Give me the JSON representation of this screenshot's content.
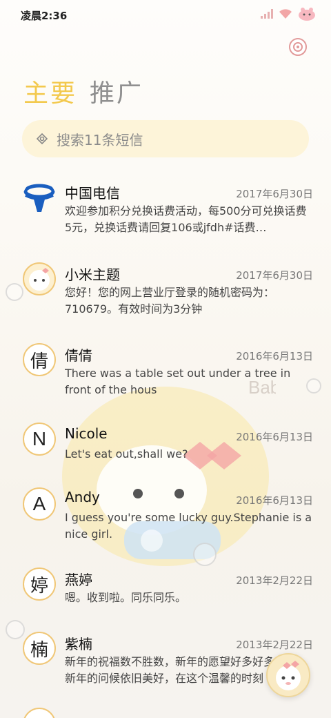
{
  "status_bar": {
    "time": "凌晨2:36"
  },
  "tabs": [
    {
      "label": "主要",
      "active": true
    },
    {
      "label": "推广",
      "active": false
    }
  ],
  "search": {
    "placeholder": "搜索11条短信"
  },
  "threads": [
    {
      "name": "中国电信",
      "date": "2017年6月30日",
      "preview": "欢迎参加积分兑换话费活动，每500分可兑换话费5元，兑换话费请回复106或jfdh#话费…",
      "avatar": ""
    },
    {
      "name": "小米主题",
      "date": "2017年6月30日",
      "preview": "您好！您的网上营业厅登录的随机密码为：710679。有效时间为3分钟",
      "avatar": ""
    },
    {
      "name": "倩倩",
      "date": "2016年6月13日",
      "preview": "There was a table set out under a tree in front of the hous",
      "avatar": "倩"
    },
    {
      "name": "Nicole",
      "date": "2016年6月13日",
      "preview": "Let's eat out,shall we?",
      "avatar": "N"
    },
    {
      "name": "Andy",
      "date": "2016年6月13日",
      "preview": "I guess you're some lucky guy.Stephanie is a nice girl.",
      "avatar": "A"
    },
    {
      "name": "燕婷",
      "date": "2013年2月22日",
      "preview": "嗯。收到啦。同乐同乐。",
      "avatar": "婷"
    },
    {
      "name": "紫楠",
      "date": "2013年2月22日",
      "preview": "新年的祝福数不胜数，新年的愿望好多好多，新年的问候依旧美好，在这个温馨的时刻",
      "avatar": "楠"
    }
  ],
  "colors": {
    "accent": "#f3c94e",
    "search_bg": "#fdf4d9",
    "avatar_border": "#f0c777",
    "telecom_blue": "#1a5ebf"
  }
}
